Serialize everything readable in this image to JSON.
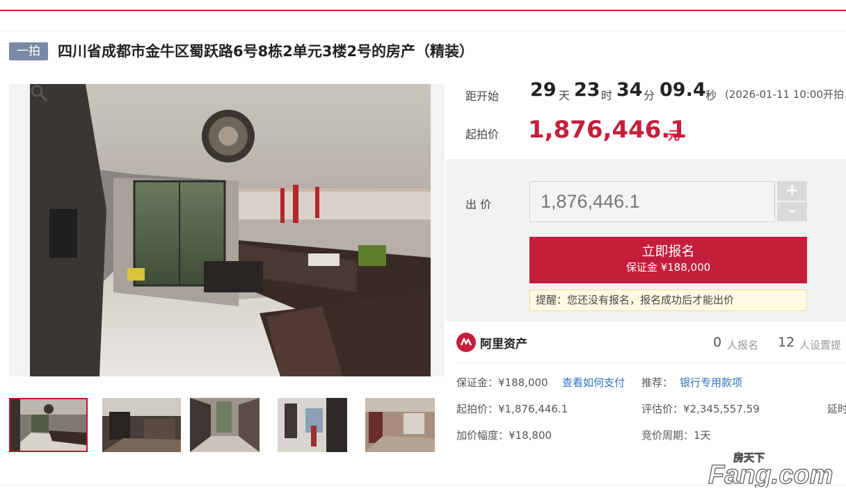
{
  "header": {
    "badge": "一拍",
    "title": "四川省成都市金牛区蜀跃路6号8栋2单元3楼2号的房产（精装）"
  },
  "gallery": {
    "zoom_icon": "magnifier-icon",
    "thumbnail_count": 5
  },
  "countdown": {
    "label": "距开始",
    "days": "29",
    "days_unit": "天",
    "hours": "23",
    "hours_unit": "时",
    "minutes": "34",
    "minutes_unit": "分",
    "seconds": "09.4",
    "seconds_unit": "秒",
    "start_time": "(2026-01-11 10:00开拍"
  },
  "price": {
    "label": "起拍价",
    "value": "1,876,446.1",
    "unit": "元"
  },
  "bid": {
    "label": "出 价",
    "input_value": "1,876,446.1",
    "plus": "+",
    "minus": "-",
    "signup_label": "立即报名",
    "deposit_line": "保证金 ¥188,000",
    "reminder": "提醒：您还没有报名，报名成功后才能出价"
  },
  "platform": {
    "name": "阿里资产",
    "signup_count": "0",
    "signup_label": "人报名",
    "reminder_count": "12",
    "reminder_label": "人设置提"
  },
  "details": {
    "deposit": "保证金：¥188,000",
    "how_to_pay": "查看如何支付",
    "recommend_label": "推荐：",
    "recommend_link": "银行专用款项",
    "start_price": "起拍价：¥1,876,446.1",
    "appraisal": "评估价：¥2,345,557.59",
    "extension": "延时",
    "increment": "加价幅度：¥18,800",
    "cycle": "竞价周期：1天"
  },
  "watermark": {
    "top": "房天下",
    "brand": "Fang.com"
  },
  "colors": {
    "accent": "#c41e3a",
    "badge": "#7a8aa6",
    "link": "#2d6fc4"
  }
}
